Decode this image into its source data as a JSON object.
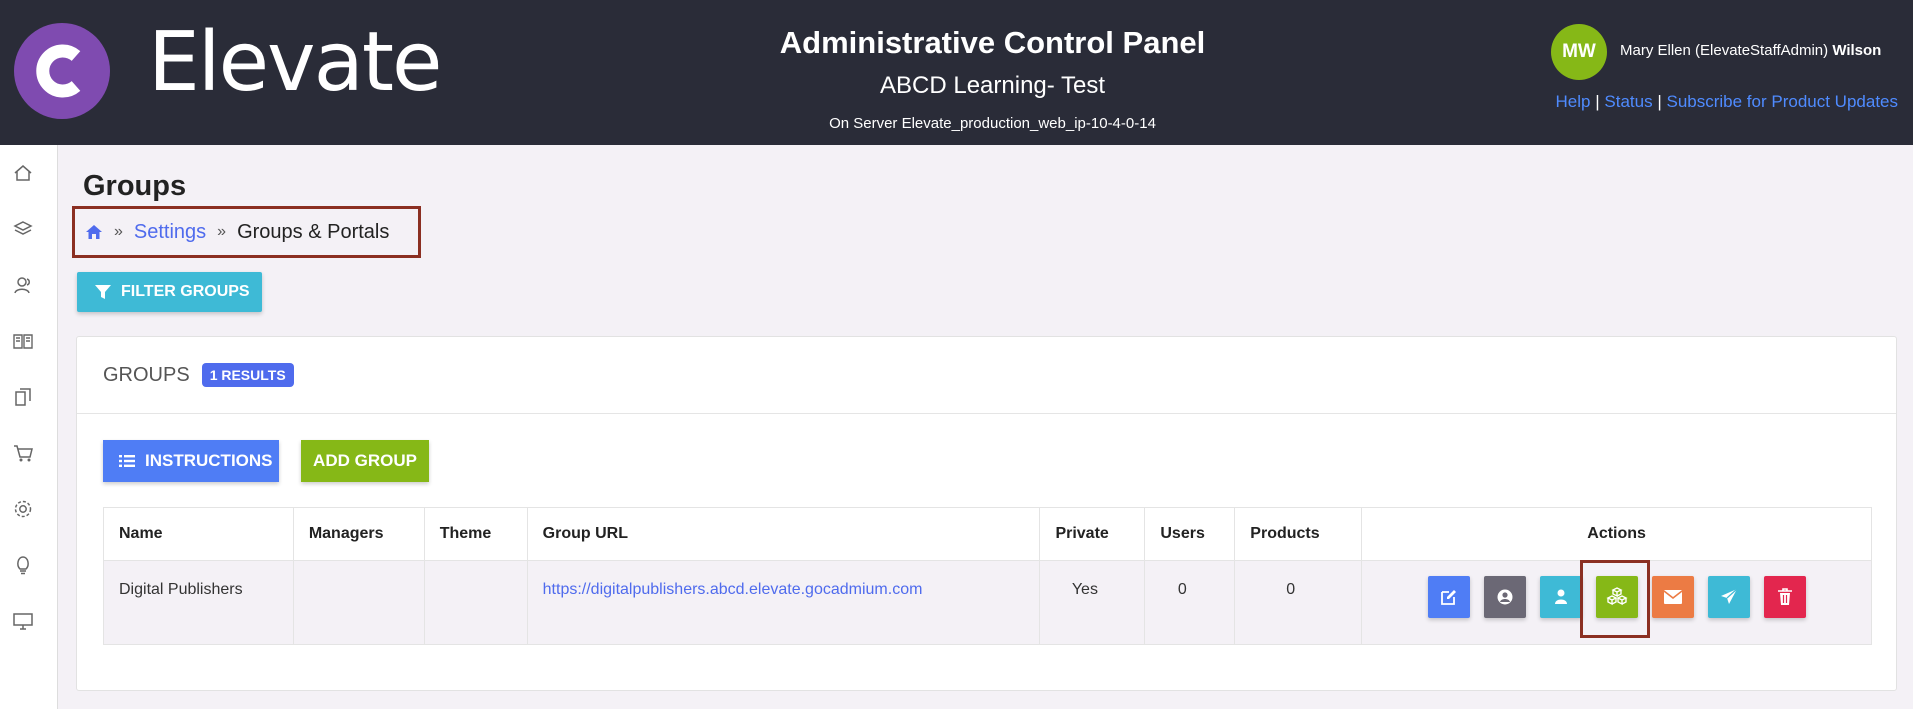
{
  "header": {
    "brand": "Elevate",
    "title": "Administrative Control Panel",
    "subtitle": "ABCD Learning- Test",
    "server": "On Server Elevate_production_web_ip-10-4-0-14",
    "user_initials": "MW",
    "user_name": "Mary Ellen (ElevateStaffAdmin)",
    "user_last": "Wilson",
    "links": {
      "help": "Help",
      "status": "Status",
      "subscribe": "Subscribe for Product Updates"
    },
    "sep": "|"
  },
  "sidebar": {
    "items": [
      "home-icon",
      "layers-icon",
      "users-icon",
      "book-icon",
      "copy-icon",
      "cart-icon",
      "gear-icon",
      "lightbulb-icon",
      "monitor-icon"
    ]
  },
  "page": {
    "title": "Groups",
    "breadcrumb": {
      "settings": "Settings",
      "current": "Groups & Portals",
      "sep": "»"
    },
    "filter_label": "FILTER GROUPS"
  },
  "panel": {
    "title": "GROUPS",
    "badge": "1 RESULTS",
    "instructions_label": "INSTRUCTIONS",
    "add_label": "ADD GROUP"
  },
  "table": {
    "columns": [
      "Name",
      "Managers",
      "Theme",
      "Group URL",
      "Private",
      "Users",
      "Products",
      "Actions"
    ],
    "rows": [
      {
        "name": "Digital Publishers",
        "managers": "",
        "theme": "",
        "url": "https://digitalpublishers.abcd.elevate.gocadmium.com",
        "private": "Yes",
        "users": "0",
        "products": "0"
      }
    ]
  },
  "colors": {
    "header_bg": "#2a2c38",
    "logo": "#7f4bb0",
    "primary": "#4f6bed",
    "green": "#86b817",
    "cyan": "#3ebad6",
    "orange": "#ec7b44",
    "red": "#e3264e",
    "gray": "#6b6875",
    "highlight": "#8b2f22"
  }
}
